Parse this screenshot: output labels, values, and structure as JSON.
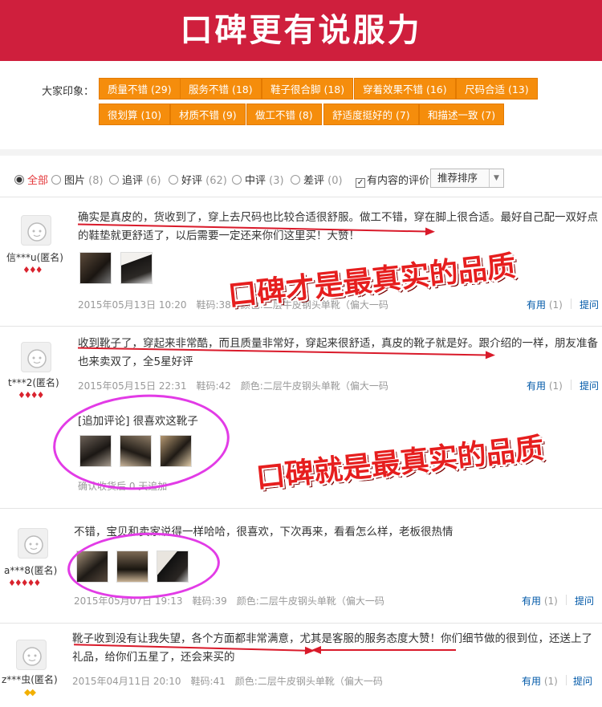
{
  "banner": {
    "title": "口碑更有说服力"
  },
  "impressions": {
    "label": "大家印象：",
    "tags": [
      "质量不错 (29)",
      "服务不错 (18)",
      "鞋子很合脚 (18)",
      "穿着效果不错 (16)",
      "尺码合适 (13)",
      "很划算 (10)",
      "材质不错 (9)",
      "做工不错 (8)",
      "舒适度挺好的 (7)",
      "和描述一致 (7)"
    ]
  },
  "filters": {
    "options": [
      {
        "label": "全部",
        "count": ""
      },
      {
        "label": "图片",
        "count": "(8)"
      },
      {
        "label": "追评",
        "count": "(6)"
      },
      {
        "label": "好评",
        "count": "(62)"
      },
      {
        "label": "中评",
        "count": "(3)"
      },
      {
        "label": "差评",
        "count": "(0)"
      }
    ],
    "has_content_label": "有内容的评价",
    "sort_value": "推荐排序"
  },
  "reviews": [
    {
      "user": "信***u(匿名)",
      "rank": "♦♦♦",
      "text": "确实是真皮的，货收到了，穿上去尺码也比较合适很舒服。做工不错，穿在脚上很合适。最好自己配一双好点的鞋垫就更舒适了，以后需要一定还来你们这里买！大赞！",
      "meta": "2015年05月13日 10:20　鞋码:38　颜色:二层牛皮钢头单靴（偏大一码",
      "useful": "有用",
      "useful_count": "(1)",
      "reply": "提问"
    },
    {
      "user": "t***2(匿名)",
      "rank": "♦♦♦♦",
      "text": "收到靴子了，穿起来非常酷，而且质量非常好，穿起来很舒适，真皮的靴子就是好。跟介绍的一样，朋友准备也来卖双了，全5星好评",
      "meta": "2015年05月15日 22:31　鞋码:42　颜色:二层牛皮钢头单靴（偏大一码",
      "append": "[追加评论] 很喜欢这靴子",
      "append_time": "确认收货后 0 天追加",
      "useful": "有用",
      "useful_count": "(1)",
      "reply": "提问"
    },
    {
      "user": "a***8(匿名)",
      "rank": "♦♦♦♦♦",
      "text": "不错，宝贝和卖家说得一样哈哈，很喜欢，下次再来，看看怎么样，老板很热情",
      "meta": "2015年05月07日 19:13　鞋码:39　颜色:二层牛皮钢头单靴（偏大一码",
      "useful": "有用",
      "useful_count": "(1)",
      "reply": "提问"
    },
    {
      "user": "z***虫(匿名)",
      "rank": "◆◆",
      "text": "靴子收到没有让我失望，各个方面都非常满意，尤其是客服的服务态度大赞！你们细节做的很到位，还送上了礼品，给你们五星了，还会来买的",
      "meta": "2015年04月11日 20:10　鞋码:41　颜色:二层牛皮钢头单靴（偏大一码",
      "useful": "有用",
      "useful_count": "(1)",
      "reply": "提问"
    }
  ],
  "overlays": {
    "slogan1": "口碑才是最真实的品质",
    "slogan2": "口碑就是最真实的品质"
  },
  "colors": {
    "banner": "#cf1f3d",
    "tag": "#f58d0c",
    "link": "#0058a8",
    "highlight": "#e23be6"
  }
}
